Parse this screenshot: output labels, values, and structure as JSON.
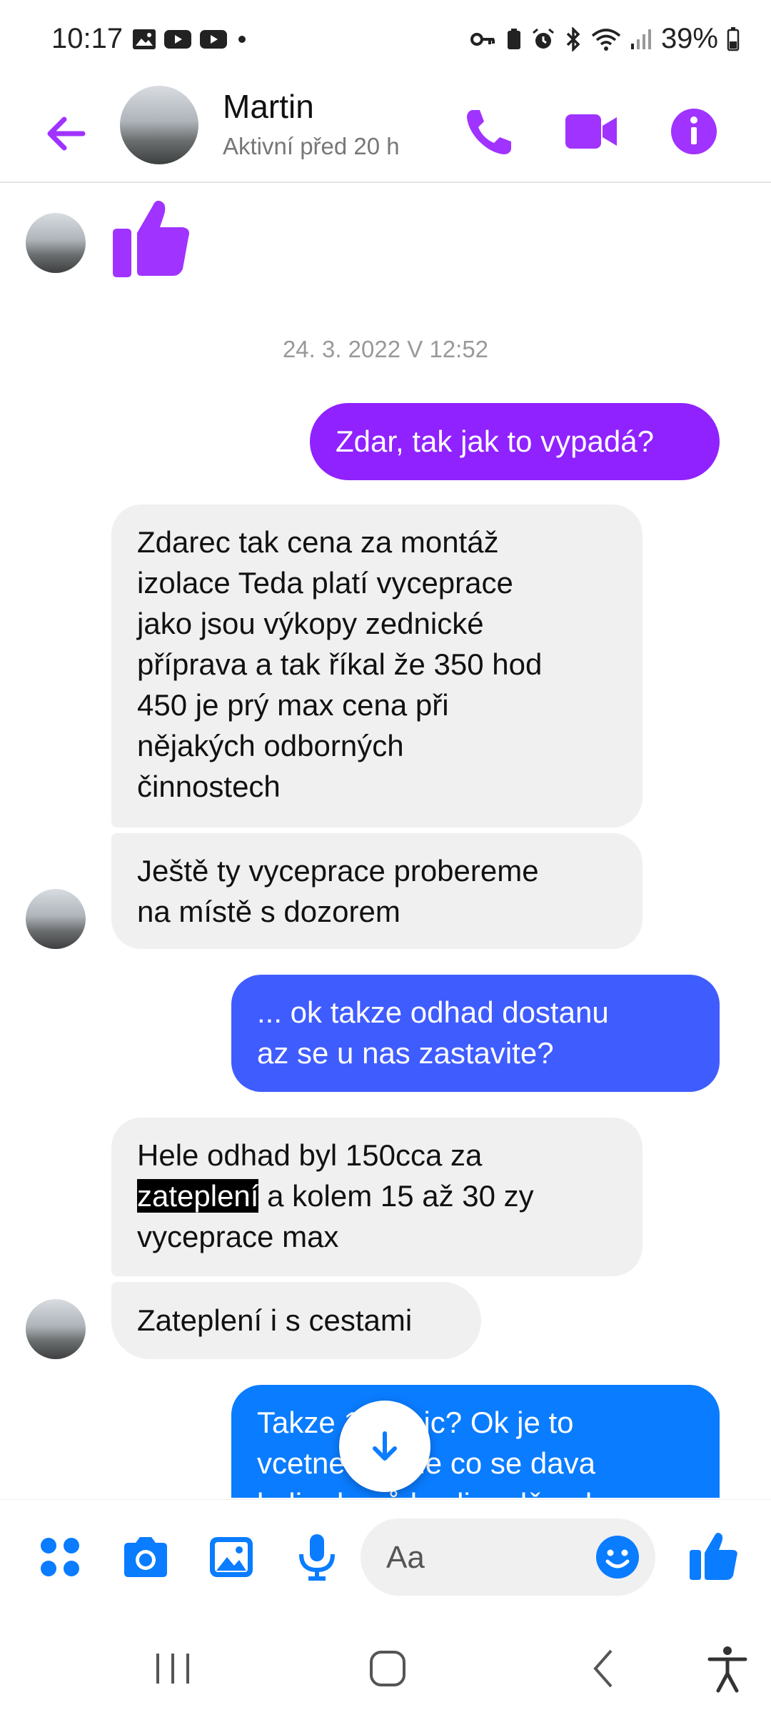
{
  "status_bar": {
    "time": "10:17",
    "battery": "39%"
  },
  "header": {
    "name": "Martin",
    "subtitle": "Aktivní před 20 h"
  },
  "date_separator": "24. 3. 2022 V 12:52",
  "messages": {
    "out_1": "Zdar, tak jak to vypadá?",
    "in_1": [
      "Zdarec tak cena za montáž",
      "izolace Teda platí vyceprace",
      "jako jsou výkopy zednické",
      "příprava a tak říkal že 350 hod",
      "450 je prý max cena při",
      "nějakých odborných",
      "činnostech"
    ],
    "in_2": [
      "Ještě ty vyceprace probereme",
      "na místě s dozorem"
    ],
    "out_2": [
      "... ok takze odhad dostanu",
      "az se u nas zastavite?"
    ],
    "in_3": {
      "line1": "Hele odhad byl 150cca za",
      "highlight": "zateplení",
      "line2_rest": " a kolem 15 až 30 zy",
      "line3": "vyceprace max"
    },
    "in_4": "Zateplení i s cestami",
    "out_3": [
      "Takze 180tisic? Ok je to",
      "vcetne te folie co se dava",
      "kolin domů kvuli vodě nebo"
    ]
  },
  "composer": {
    "placeholder": "Aa"
  },
  "colors": {
    "accent_purple": "#a033ff",
    "accent_blue": "#0a7cff",
    "bubble_grey": "#f0f0f0"
  },
  "icons": [
    "back-arrow-icon",
    "phone-icon",
    "video-icon",
    "info-icon",
    "like-icon",
    "apps-icon",
    "camera-icon",
    "gallery-icon",
    "mic-icon",
    "emoji-icon",
    "scroll-down-icon",
    "recents-nav-icon",
    "home-nav-icon",
    "back-nav-icon",
    "accessibility-icon"
  ]
}
